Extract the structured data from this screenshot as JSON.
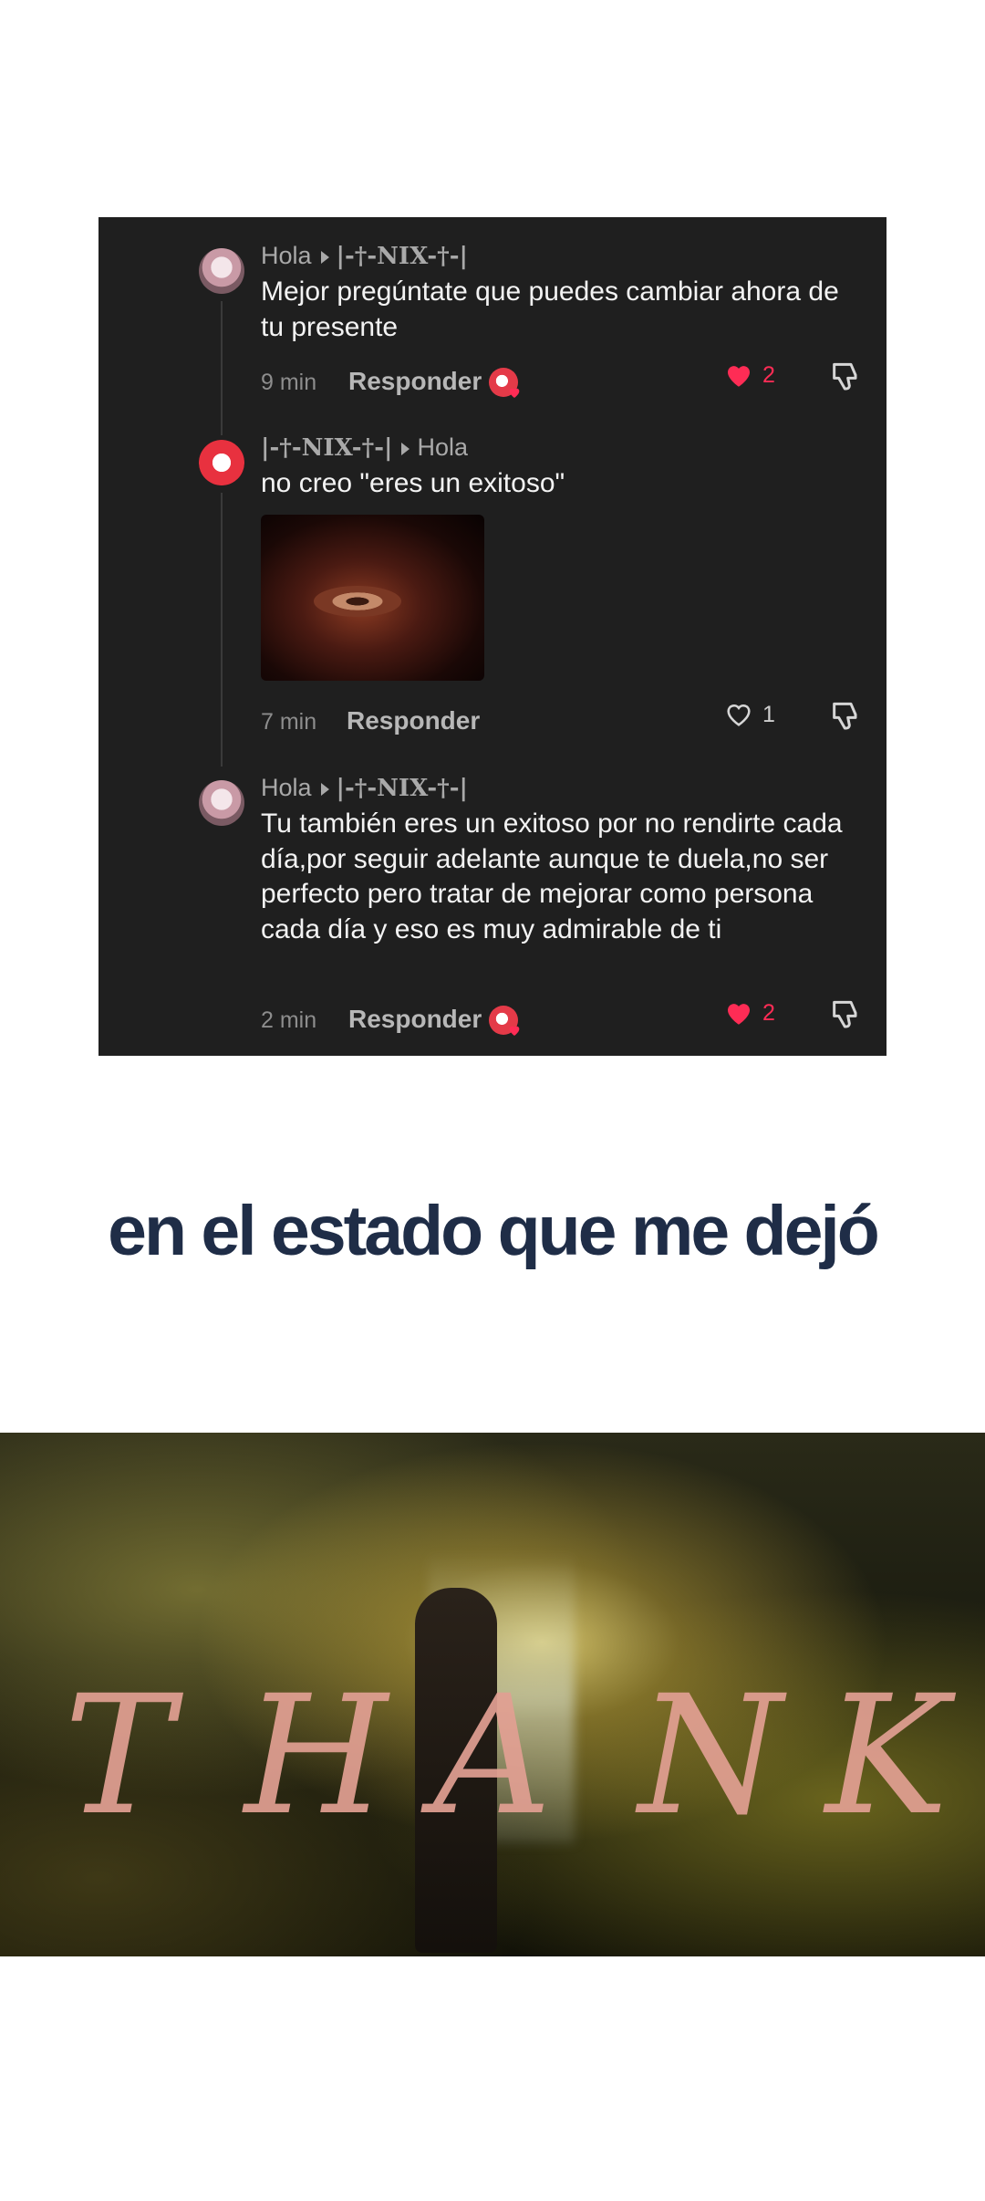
{
  "comments": [
    {
      "from": "Hola",
      "to": "|-†-NIX-†-|",
      "text": "Mejor pregúntate que puedes cambiar ahora de tu presente",
      "time": "9 min",
      "reply_label": "Responder",
      "likes": "2",
      "liked": true,
      "author_liked": true
    },
    {
      "from": "|-†-NIX-†-|",
      "to": "Hola",
      "text": "no creo \"eres un exitoso\"",
      "time": "7 min",
      "reply_label": "Responder",
      "likes": "1",
      "liked": false,
      "author_liked": false
    },
    {
      "from": "Hola",
      "to": "|-†-NIX-†-|",
      "text": "Tu también eres un exitoso por no rendirte cada día,por seguir adelante aunque te duela,no ser perfecto pero tratar de mejorar como persona cada día y eso es muy admirable de ti",
      "time": "2 min",
      "reply_label": "Responder",
      "likes": "2",
      "liked": true,
      "author_liked": true
    }
  ],
  "headline": "en el estado que me dejó",
  "scene_letters": [
    "T",
    "H",
    "A",
    "N",
    "K"
  ],
  "colors": {
    "panel": "#1f1f1f",
    "like_active": "#fe2c55",
    "headline": "#1f2d47"
  }
}
